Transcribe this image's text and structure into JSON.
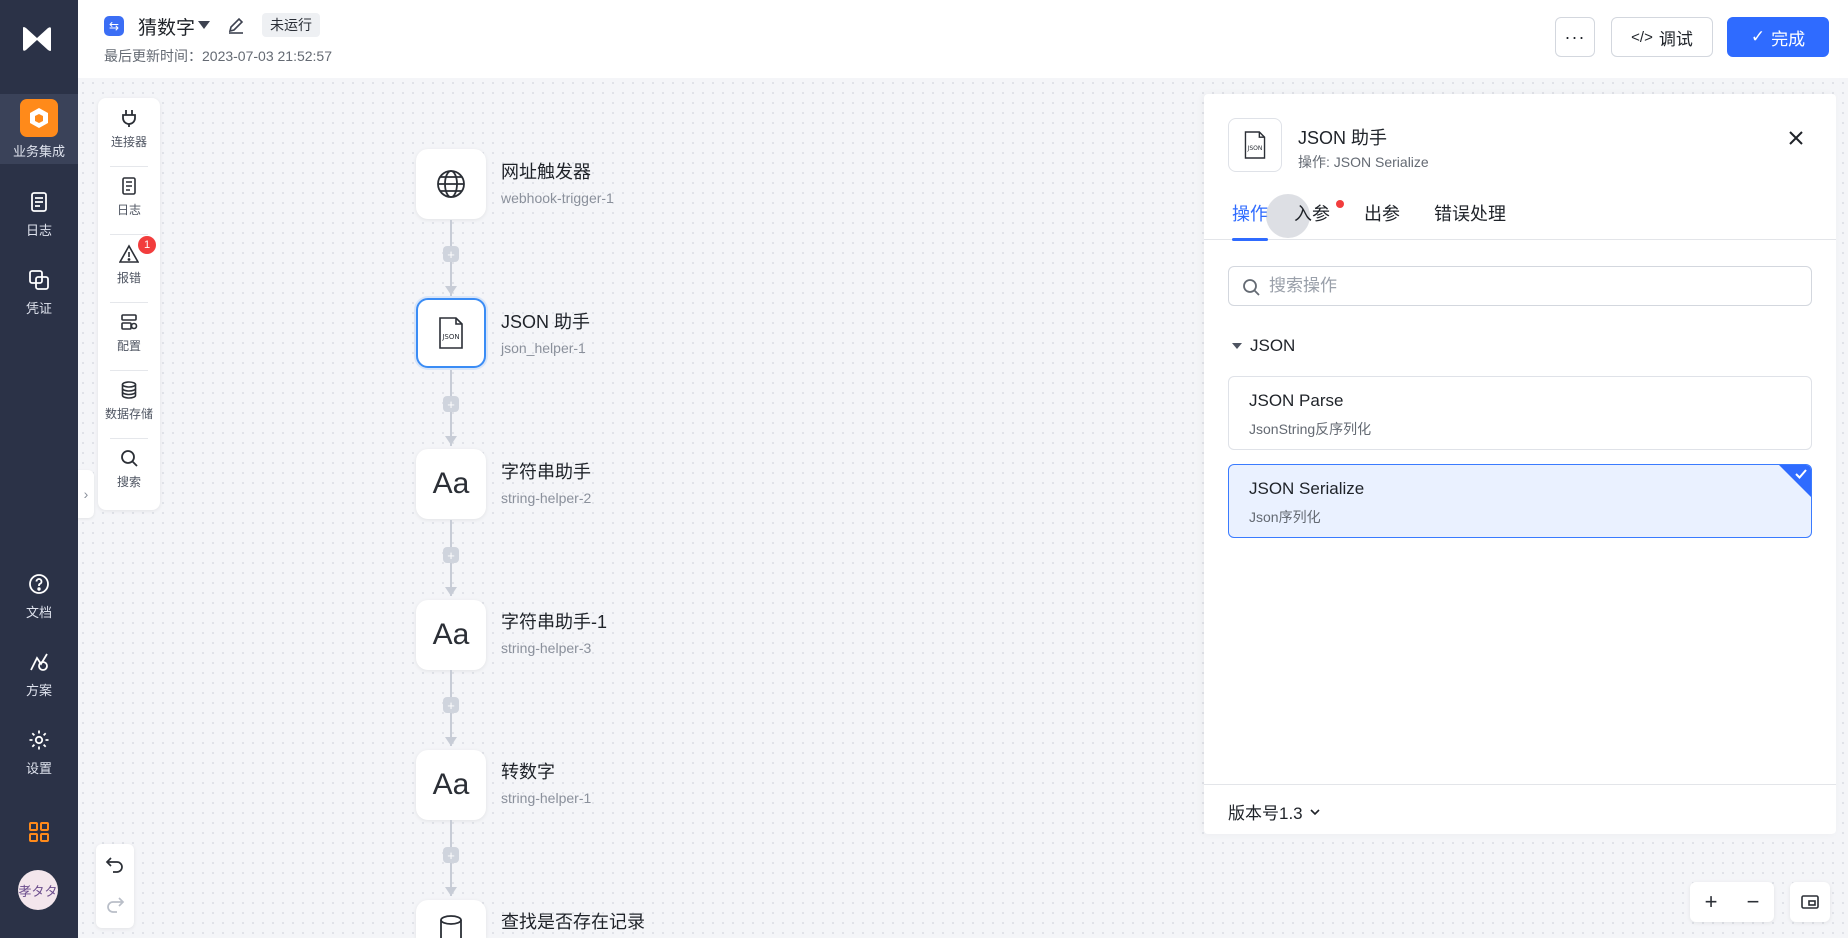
{
  "sidebar": {
    "items": [
      {
        "label": "业务集成",
        "icon": "cube-icon",
        "active": true
      },
      {
        "label": "日志",
        "icon": "log-icon"
      },
      {
        "label": "凭证",
        "icon": "credential-icon"
      },
      {
        "label": "文档",
        "icon": "help-icon"
      },
      {
        "label": "方案",
        "icon": "solution-icon"
      },
      {
        "label": "设置",
        "icon": "gear-icon"
      }
    ],
    "avatar_text": "孝タタ",
    "accent": "#ff8a1a"
  },
  "header": {
    "flow_name": "猜数字",
    "status": "未运行",
    "updated_label": "最后更新时间：2023-07-03 21:52:57",
    "more_label": "···",
    "debug_label": "调试",
    "done_label": "完成",
    "primary_color": "#2f6bff"
  },
  "tools": [
    {
      "label": "连接器",
      "icon": "plug-icon"
    },
    {
      "label": "日志",
      "icon": "document-icon"
    },
    {
      "label": "报错",
      "icon": "warning-icon",
      "badge": "1"
    },
    {
      "label": "配置",
      "icon": "config-icon"
    },
    {
      "label": "数据存储",
      "icon": "database-icon"
    },
    {
      "label": "搜索",
      "icon": "search-icon"
    }
  ],
  "nodes": [
    {
      "title": "网址触发器",
      "sub": "webhook-trigger-1",
      "icon": "globe-icon"
    },
    {
      "title": "JSON 助手",
      "sub": "json_helper-1",
      "icon": "json-file-icon",
      "selected": true
    },
    {
      "title": "字符串助手",
      "sub": "string-helper-2",
      "icon": "text-icon",
      "glyph": "Aa"
    },
    {
      "title": "字符串助手-1",
      "sub": "string-helper-3",
      "icon": "text-icon",
      "glyph": "Aa"
    },
    {
      "title": "转数字",
      "sub": "string-helper-1",
      "icon": "text-icon",
      "glyph": "Aa"
    },
    {
      "title": "查找是否存在记录",
      "sub": "",
      "icon": "database-icon"
    }
  ],
  "panel": {
    "title": "JSON 助手",
    "subtitle": "操作: JSON Serialize",
    "tabs": [
      "操作",
      "入参",
      "出参",
      "错误处理"
    ],
    "active_tab": 0,
    "search_placeholder": "搜索操作",
    "group": "JSON",
    "operations": [
      {
        "name": "JSON Parse",
        "desc": "JsonString反序列化"
      },
      {
        "name": "JSON Serialize",
        "desc": "Json序列化",
        "selected": true
      }
    ],
    "version_label": "版本号1.3"
  },
  "canvas_controls": {
    "zoom_in": "+",
    "zoom_out": "−"
  }
}
